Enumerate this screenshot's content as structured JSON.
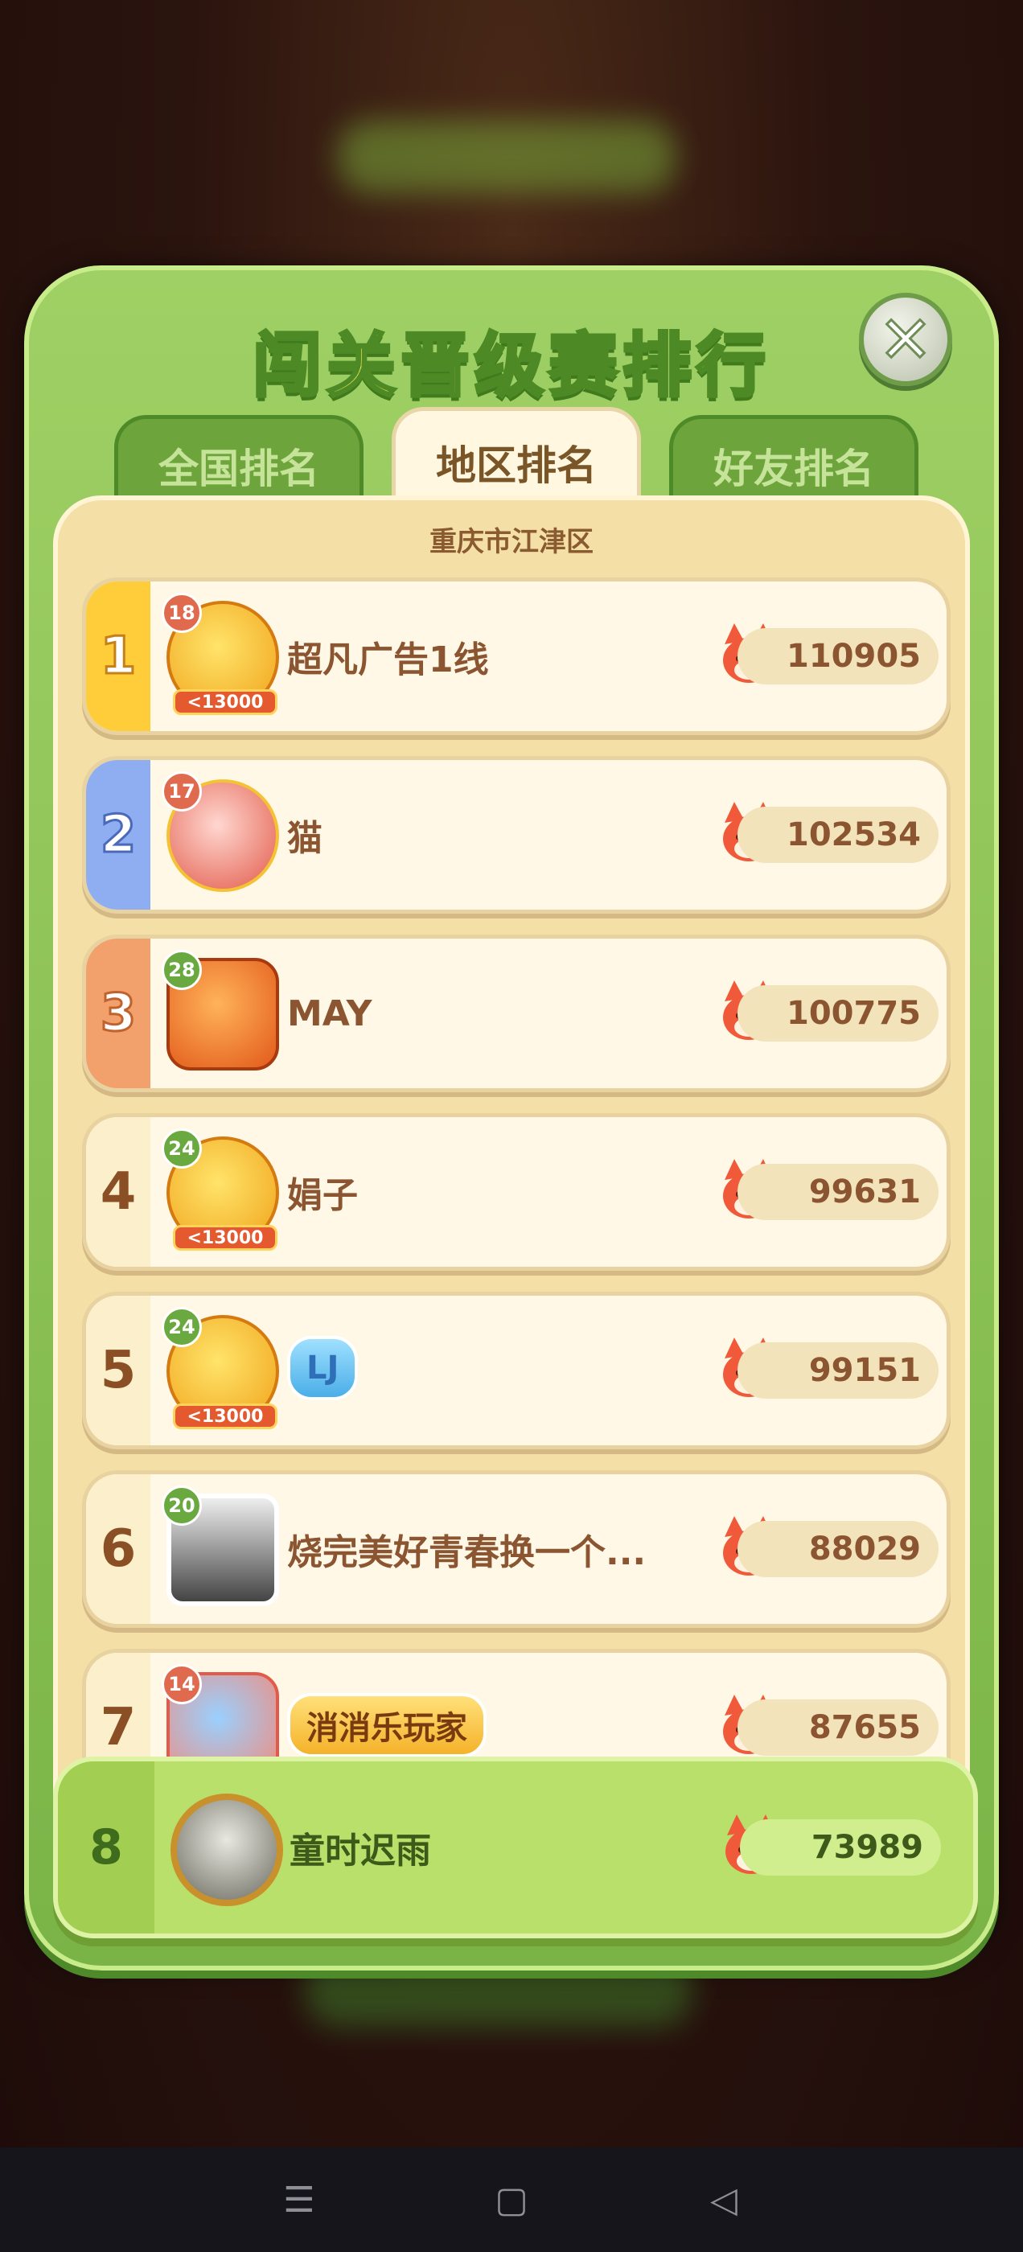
{
  "title": "闯关晋级赛排行",
  "tabs": [
    {
      "label": "全国排名",
      "active": false
    },
    {
      "label": "地区排名",
      "active": true
    },
    {
      "label": "好友排名",
      "active": false
    }
  ],
  "region": "重庆市江津区",
  "rows": [
    {
      "rank": "1",
      "level": "18",
      "name": "超凡广告1线",
      "score": "110905",
      "banner": "13000"
    },
    {
      "rank": "2",
      "level": "17",
      "name": "猫",
      "score": "102534"
    },
    {
      "rank": "3",
      "level": "28",
      "name": "MAY",
      "score": "100775"
    },
    {
      "rank": "4",
      "level": "24",
      "name": "娟子",
      "score": "99631",
      "banner": "13000"
    },
    {
      "rank": "5",
      "level": "24",
      "name": "LJ",
      "score": "99151",
      "banner": "13000"
    },
    {
      "rank": "6",
      "level": "20",
      "name": "烧完美好青春换一个...",
      "score": "88029"
    },
    {
      "rank": "7",
      "level": "14",
      "name": "消消乐玩家",
      "score": "87655"
    }
  ],
  "me": {
    "rank": "8",
    "name": "童时迟雨",
    "score": "73989"
  },
  "icons": {
    "close": "close-icon",
    "score": "fox-icon"
  },
  "nav": {
    "menu": "☰",
    "home": "▢",
    "back": "◁"
  },
  "colors": {
    "panel": "#9fd065",
    "title": "#ffef5a",
    "gold": "#ffcc3a",
    "silver": "#8faef2",
    "bronze": "#f2a06c"
  }
}
